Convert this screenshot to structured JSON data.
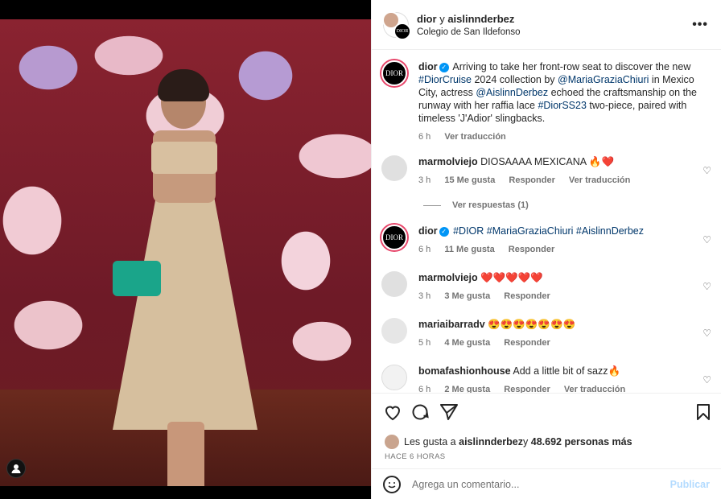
{
  "header": {
    "account": "dior",
    "connector": "y",
    "collab": "aislinnderbez",
    "location": "Colegio de San Ildefonso",
    "more_icon": "more-dots-icon"
  },
  "caption": {
    "avatar_text": "DIOR",
    "user": "dior",
    "text_1": " Arriving to take her front-row seat to discover the new ",
    "tag_1": "#DiorCruise",
    "text_2": " 2024 collection by ",
    "tag_2": "@MariaGraziaChiuri",
    "text_3": " in Mexico City, actress ",
    "tag_3": "@AislinnDerbez",
    "text_4": " echoed the craftsmanship on the runway with her raffia lace ",
    "tag_4": "#DiorSS23",
    "text_5": " two-piece, paired with timeless 'J'Adior' slingbacks.",
    "time": "6 h",
    "translate": "Ver traducción"
  },
  "comments": [
    {
      "user": "marmolviejo",
      "text": "DIOSAAAA MEXICANA 🔥❤️",
      "time": "3 h",
      "likes": "15 Me gusta",
      "reply": "Responder",
      "translate": "Ver traducción"
    },
    {
      "user": "dior",
      "avatar_text": "DIOR",
      "tags": "#DIOR #MariaGraziaChiuri #AislinnDerbez",
      "time": "6 h",
      "likes": "11 Me gusta",
      "reply": "Responder"
    },
    {
      "user": "marmolviejo",
      "text": "❤️❤️❤️❤️❤️",
      "time": "3 h",
      "likes": "3 Me gusta",
      "reply": "Responder"
    },
    {
      "user": "mariaibarradv",
      "text": "😍😍😍😍😍😍😍",
      "time": "5 h",
      "likes": "4 Me gusta",
      "reply": "Responder"
    },
    {
      "user": "bomafashionhouse",
      "text": "Add a little bit of sazz🔥",
      "time": "6 h",
      "likes": "2 Me gusta",
      "reply": "Responder",
      "translate": "Ver traducción"
    }
  ],
  "replies_link": "Ver respuestas (1)",
  "likes": {
    "prefix": "Les gusta a ",
    "user": "aislinnderbez",
    "middle": " y ",
    "count": "48.692 personas más"
  },
  "post_time": "HACE 6 HORAS",
  "add_comment": {
    "placeholder": "Agrega un comentario...",
    "publish": "Publicar"
  },
  "colors": {
    "link": "#00376b",
    "verified": "#0095f6",
    "publish_disabled": "#b3dbff"
  }
}
